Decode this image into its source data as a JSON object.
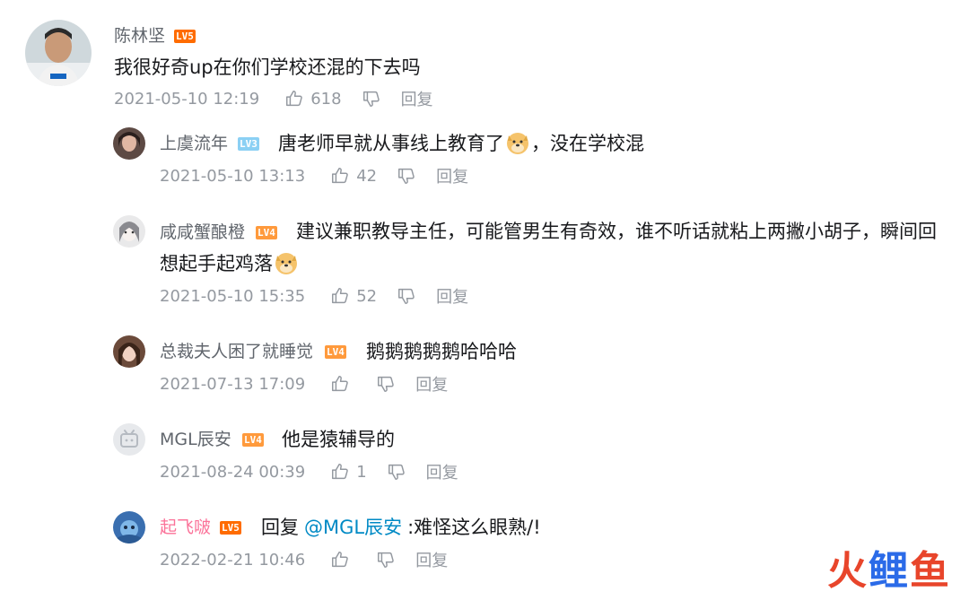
{
  "comments": [
    {
      "username": "陈林坚",
      "level": "LV5",
      "content": "我很好奇up在你们学校还混的下去吗",
      "time": "2021-05-10 12:19",
      "likes": "618",
      "reply_label": "回复"
    }
  ],
  "replies": [
    {
      "username": "上虞流年",
      "level": "LV3",
      "content_before": "唐老师早就从事线上教育了",
      "content_after": "，没在学校混",
      "time": "2021-05-10 13:13",
      "likes": "42",
      "reply_label": "回复"
    },
    {
      "username": "咸咸蟹酿橙",
      "level": "LV4",
      "content_before": "建议兼职教导主任，可能管男生有奇效，谁不听话就粘上两撇小胡子，瞬间回想起手起鸡落",
      "content_after": "",
      "time": "2021-05-10 15:35",
      "likes": "52",
      "reply_label": "回复"
    },
    {
      "username": "总裁夫人困了就睡觉",
      "level": "LV4",
      "content": "鹅鹅鹅鹅鹅哈哈哈",
      "time": "2021-07-13 17:09",
      "likes": "",
      "reply_label": "回复"
    },
    {
      "username": "MGL辰安",
      "level": "LV4",
      "content": "他是猿辅导的",
      "time": "2021-08-24 00:39",
      "likes": "1",
      "reply_label": "回复"
    },
    {
      "username": "起飞啵",
      "level": "LV5",
      "reply_prefix": "回复",
      "mention": "@MGL辰安",
      "content": ":难怪这么眼熟/!",
      "time": "2022-02-21 10:46",
      "likes": "",
      "reply_label": "回复"
    }
  ],
  "watermark": {
    "chars": [
      "火",
      "鲤",
      "鱼"
    ]
  },
  "colors": {
    "username": "#61666d",
    "username_vip": "#fb7299",
    "meta": "#9499a0",
    "mention": "#008ac5",
    "lv5": "#ff6c00",
    "lv4": "#ff9a3c",
    "lv3": "#8bd0f4",
    "watermark_red": "#e8452b",
    "watermark_blue": "#2b6be8"
  },
  "icons": {
    "like": "thumbs-up-icon",
    "dislike": "thumbs-down-icon",
    "emoji": "doge-emoji"
  }
}
